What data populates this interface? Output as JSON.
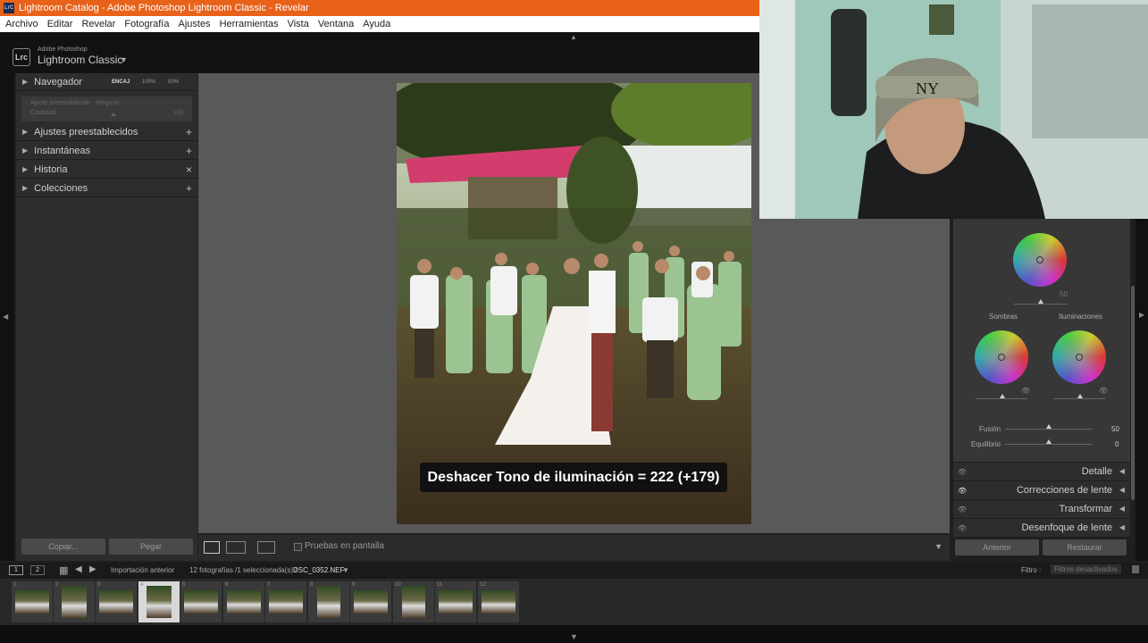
{
  "window": {
    "title": "Lightroom Catalog - Adobe Photoshop Lightroom Classic - Revelar",
    "app_icon_text": "LrC"
  },
  "menu": [
    "Archivo",
    "Editar",
    "Revelar",
    "Fotografía",
    "Ajustes",
    "Herramientas",
    "Vista",
    "Ventana",
    "Ayuda"
  ],
  "brand": {
    "logo_text": "Lrc",
    "line1": "Adobe Photoshop",
    "line2": "Lightroom Classic"
  },
  "left_panel": {
    "navigator": {
      "label": "Navegador",
      "zoom": [
        "ENCAJ",
        "100%",
        "50%"
      ]
    },
    "preset_box": {
      "line1": "Ajuste preestablecido · Ninguno",
      "line2": "Cantidad",
      "value": "100"
    },
    "sections": [
      {
        "label": "Ajustes preestablecidos",
        "action": "+"
      },
      {
        "label": "Instantáneas",
        "action": "+"
      },
      {
        "label": "Historia",
        "action": "×"
      },
      {
        "label": "Colecciones",
        "action": "+"
      }
    ],
    "copy_button": "Copiar...",
    "paste_button": "Pegar"
  },
  "photo": {
    "caption": "Deshacer Tono de iluminación = 222 (+179)"
  },
  "toolbar": {
    "soft_proof_label": "Pruebas en pantalla"
  },
  "right_panel": {
    "global_wheel_value": "50",
    "wheel_labels": {
      "shadows": "Sombras",
      "highlights": "Iluminaciones"
    },
    "sliders": [
      {
        "label": "Fusión",
        "value": "50",
        "position": 0.5
      },
      {
        "label": "Equilibrio",
        "value": "0",
        "position": 0.5
      }
    ],
    "sections": [
      "Detalle",
      "Correcciones de lente",
      "Transformar",
      "Desenfoque de lente"
    ],
    "prev_button": "Anterior",
    "reset_button": "Restaurar"
  },
  "filmstrip_bar": {
    "page1": "1",
    "page2": "2",
    "source": "Importación anterior",
    "count": "12 fotografías /1 seleccionada(s) /",
    "filename": "DSC_0352.NEF",
    "filter_label": "Filtro :",
    "filter_value": "Filtros desactivados"
  },
  "filmstrip": {
    "thumbs": [
      "1",
      "2",
      "3",
      "4",
      "5",
      "6",
      "7",
      "8",
      "9",
      "10",
      "11",
      "12"
    ],
    "selected_index": 3
  },
  "colors": {
    "titlebar": "#e8621a",
    "center_bg": "#595959",
    "panel_bg": "#2d2d2d"
  },
  "icons": [
    "grid-view-icon",
    "eye-icon",
    "disclosure-triangle-icon",
    "loupe-view-icon",
    "compare-view-icon"
  ]
}
